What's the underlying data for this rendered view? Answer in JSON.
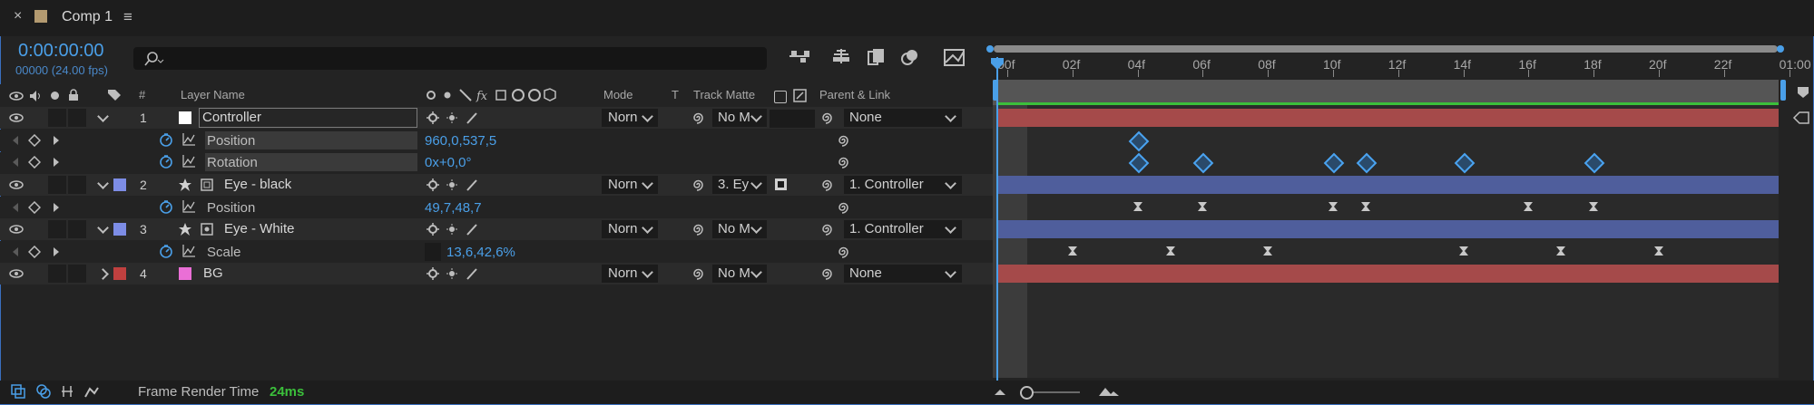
{
  "tab": {
    "title": "Comp 1",
    "close": "×",
    "menu": "≡"
  },
  "timecode": {
    "value": "0:00:00:00",
    "frames": "00000 (24.00 fps)"
  },
  "search": {
    "placeholder": ""
  },
  "columns": {
    "layer_name": "Layer Name",
    "number": "#",
    "mode": "Mode",
    "t": "T",
    "track_matte": "Track Matte",
    "parent_link": "Parent & Link"
  },
  "ruler": [
    "00f",
    "02f",
    "04f",
    "06f",
    "08f",
    "10f",
    "12f",
    "14f",
    "16f",
    "18f",
    "20f",
    "22f",
    "01:00"
  ],
  "layers": [
    {
      "num": "1",
      "name": "Controller",
      "color": "#c0403f",
      "mode": "Norn",
      "track_matte": "",
      "parent": "None"
    },
    {
      "num": "2",
      "name": "Eye - black",
      "color": "#7d8de6",
      "mode": "Norn",
      "track_matte": "3. Ey",
      "parent": "1. Controller"
    },
    {
      "num": "3",
      "name": "Eye - White",
      "color": "#7d8de6",
      "mode": "Norn",
      "track_matte": "No M",
      "parent": "1. Controller"
    },
    {
      "num": "4",
      "name": "BG",
      "color": "#c0403f",
      "mode": "Norn",
      "track_matte": "No M",
      "parent": "None"
    }
  ],
  "layer1_matte": "No M",
  "properties": [
    {
      "name": "Position",
      "value": "960,0,537,5"
    },
    {
      "name": "Rotation",
      "value": "0x+0,0°"
    },
    {
      "name": "Position",
      "value": "49,7,48,7"
    },
    {
      "name": "Scale",
      "value": "13,6,42,6%"
    }
  ],
  "footer": {
    "label": "Frame Render Time",
    "value": "24ms"
  },
  "colors": {
    "accent": "#4a9fe8",
    "red_bar": "#a54a4a",
    "blue_bar": "#4f5e9c",
    "green_line": "#3bbf3b"
  }
}
